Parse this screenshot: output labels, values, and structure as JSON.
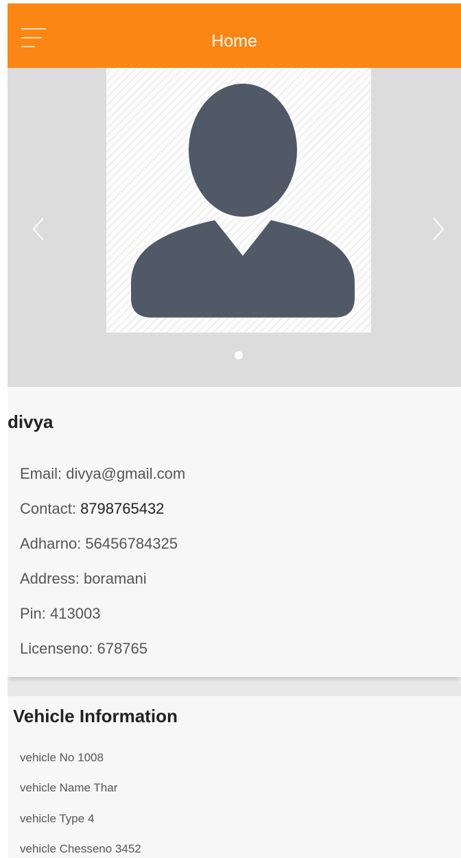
{
  "header": {
    "title": "Home",
    "menu_icon": "hamburger-menu-icon",
    "color": "#fb8613"
  },
  "slider": {
    "image": "user-avatar-placeholder",
    "prev_icon": "chevron-left-icon",
    "next_icon": "chevron-right-icon",
    "active_slide": 1,
    "total_slides": 1
  },
  "profile": {
    "name": "divya",
    "email_label": "Email:",
    "email_value": "divya@gmail.com",
    "contact_label": "Contact:",
    "contact_value": "8798765432",
    "adhar_label": "Adharno:",
    "adhar_value": "56456784325",
    "address_label": "Address:",
    "address_value": "boramani",
    "pin_label": "Pin:",
    "pin_value": "413003",
    "license_label": "Licenseno:",
    "license_value": "678765"
  },
  "vehicle": {
    "title": "Vehicle Information",
    "no_label": "vehicle No",
    "no_value": "1008",
    "name_label": "vehicle Name",
    "name_value": "Thar",
    "type_label": "vehicle Type",
    "type_value": "4",
    "chassis_label": "vehicle Chesseno",
    "chassis_value": "3452"
  }
}
